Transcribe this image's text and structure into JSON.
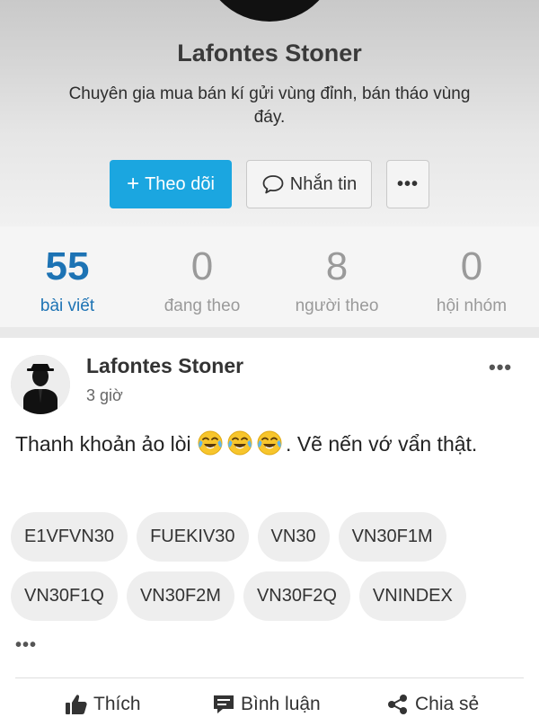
{
  "profile": {
    "name": "Lafontes Stoner",
    "bio": "Chuyên gia mua bán kí gửi vùng đỉnh, bán tháo vùng đáy.",
    "follow_label": "Theo dõi",
    "message_label": "Nhắn tin",
    "more_label": "•••"
  },
  "stats": [
    {
      "value": "55",
      "label": "bài viết"
    },
    {
      "value": "0",
      "label": "đang theo"
    },
    {
      "value": "8",
      "label": "người theo"
    },
    {
      "value": "0",
      "label": "hội nhóm"
    }
  ],
  "post": {
    "author": "Lafontes Stoner",
    "time": "3 giờ",
    "menu": "•••",
    "text_before": "Thanh khoản ảo lòi ",
    "emoji": "face-with-tears-of-joy",
    "emoji_count": 3,
    "text_after": ". Vẽ nến vớ vẩn thật.",
    "tags_row1": [
      "E1VFVN30",
      "FUEKIV30",
      "VN30",
      "VN30F1M"
    ],
    "tags_row2": [
      "VN30F1Q",
      "VN30F2M",
      "VN30F2Q",
      "VNINDEX"
    ],
    "tags_more": "•••",
    "actions": {
      "like": "Thích",
      "comment": "Bình luận",
      "share": "Chia sẻ"
    }
  },
  "colors": {
    "accent": "#1ba6e0",
    "stat_active": "#1d73b4"
  }
}
